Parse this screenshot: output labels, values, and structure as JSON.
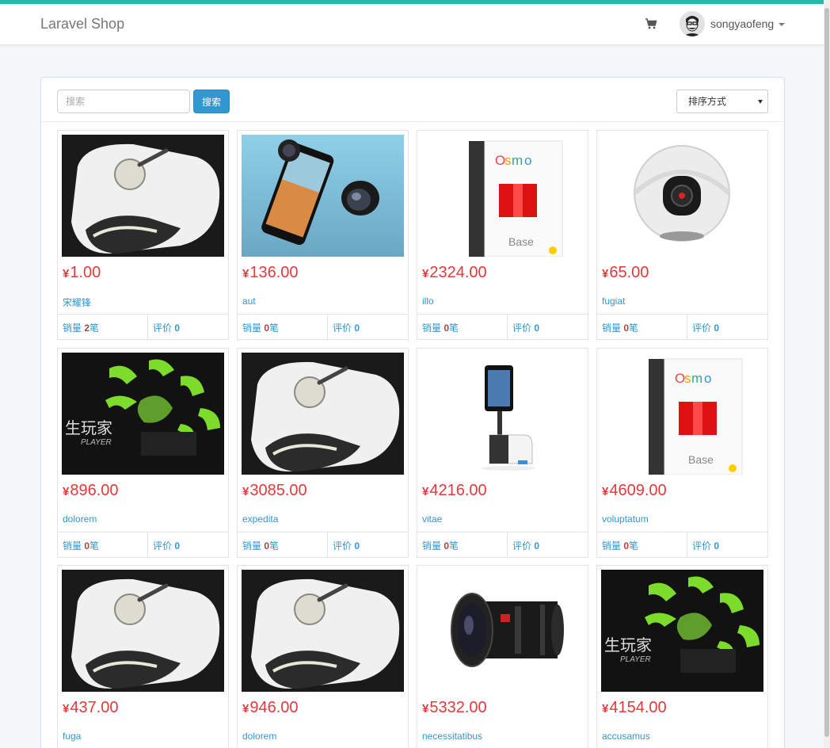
{
  "navbar": {
    "brand": "Laravel Shop",
    "username": "songyaofeng",
    "cart_icon": "cart-icon",
    "accent_color": "#2ab7a9"
  },
  "filters": {
    "search_placeholder": "搜索",
    "search_button": "搜索",
    "sort_label": "排序方式"
  },
  "colors": {
    "price": "#e4393c",
    "link": "#3097d1",
    "button": "#3097d1"
  },
  "labels": {
    "currency": "¥",
    "sold_prefix": "销量",
    "sold_suffix": "笔",
    "review_prefix": "评价"
  },
  "products": [
    {
      "price": "1.00",
      "title": "宋耀锋",
      "sold": "2",
      "reviews": "0",
      "image": "white-remote"
    },
    {
      "price": "136.00",
      "title": "aut",
      "sold": "0",
      "reviews": "0",
      "image": "phone-lens"
    },
    {
      "price": "2324.00",
      "title": "illo",
      "sold": "0",
      "reviews": "0",
      "image": "osmo-box"
    },
    {
      "price": "65.00",
      "title": "fugiat",
      "sold": "0",
      "reviews": "0",
      "image": "360-camera"
    },
    {
      "price": "896.00",
      "title": "dolorem",
      "sold": "0",
      "reviews": "0",
      "image": "green-drone"
    },
    {
      "price": "3085.00",
      "title": "expedita",
      "sold": "0",
      "reviews": "0",
      "image": "white-remote"
    },
    {
      "price": "4216.00",
      "title": "vitae",
      "sold": "0",
      "reviews": "0",
      "image": "ipad-stand"
    },
    {
      "price": "4609.00",
      "title": "voluptatum",
      "sold": "0",
      "reviews": "0",
      "image": "osmo-box"
    },
    {
      "price": "437.00",
      "title": "fuga",
      "sold": "0",
      "reviews": "0",
      "image": "white-remote"
    },
    {
      "price": "946.00",
      "title": "dolorem",
      "sold": "0",
      "reviews": "0",
      "image": "white-remote"
    },
    {
      "price": "5332.00",
      "title": "necessitatibus",
      "sold": "0",
      "reviews": "0",
      "image": "camera-lens"
    },
    {
      "price": "4154.00",
      "title": "accusamus",
      "sold": "0",
      "reviews": "0",
      "image": "green-drone"
    }
  ]
}
